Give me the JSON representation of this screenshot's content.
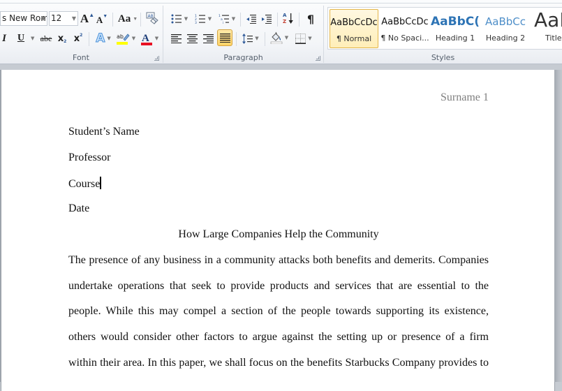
{
  "ribbon": {
    "font_group": {
      "label": "Font",
      "font_name": "s New Rom",
      "font_size": "12",
      "grow_font_label": "A",
      "shrink_font_label": "A",
      "change_case_label": "Aa",
      "bold_label": "I",
      "underline_label": "U",
      "strikethrough_label": "abe",
      "subscript_label": "x",
      "superscript_label": "x",
      "highlight_color": "#ffff00",
      "font_color": "#e81123"
    },
    "paragraph_group": {
      "label": "Paragraph",
      "pilcrow_label": "¶",
      "active_alignment": "justify"
    },
    "styles_group": {
      "label": "Styles",
      "items": [
        {
          "sample": "AaBbCcDc",
          "name": "¶ Normal",
          "active": true,
          "color": "#111111"
        },
        {
          "sample": "AaBbCcDc",
          "name": "¶ No Spaci...",
          "active": false,
          "color": "#111111"
        },
        {
          "sample": "AaBbC(",
          "name": "Heading 1",
          "active": false,
          "color": "#2e74b5"
        },
        {
          "sample": "AaBbCc",
          "name": "Heading 2",
          "active": false,
          "color": "#4f8fc9"
        },
        {
          "sample": "AaI",
          "name": "Title",
          "active": false,
          "color": "#333333"
        }
      ]
    }
  },
  "document": {
    "header": "Surname 1",
    "lines": {
      "student_name": "Student’s Name",
      "professor": "Professor",
      "course": "Course",
      "date": "Date"
    },
    "title": "How Large Companies Help the Community",
    "paragraph_lines": [
      "The presence of any business in a community attacks both benefits and demerits. Companies",
      "undertake operations that seek to provide products and services that are essential to the",
      "people. While this may compel a section of the people towards supporting its existence,",
      "others would consider other factors to argue against the setting up or presence of a firm",
      "within their area. In this paper, we shall focus on the benefits Starbucks Company provides to"
    ]
  }
}
